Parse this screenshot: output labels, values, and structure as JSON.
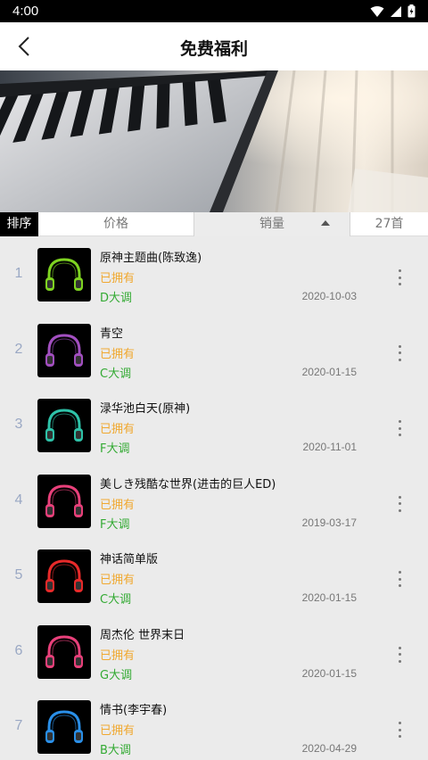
{
  "status_bar": {
    "time": "4:00"
  },
  "header": {
    "title": "免费福利"
  },
  "sort_bar": {
    "label": "排序",
    "price": "价格",
    "sales": "销量",
    "count": "27首"
  },
  "songs": [
    {
      "rank": "1",
      "title": "原神主题曲(陈致逸)",
      "owned": "已拥有",
      "key": "D大调",
      "date": "2020-10-03",
      "accent": "#7ed321"
    },
    {
      "rank": "2",
      "title": "青空",
      "owned": "已拥有",
      "key": "C大调",
      "date": "2020-01-15",
      "accent": "#a24fc0"
    },
    {
      "rank": "3",
      "title": "渌华池白天(原神)",
      "owned": "已拥有",
      "key": "F大调",
      "date": "2020-11-01",
      "accent": "#2ec2a8"
    },
    {
      "rank": "4",
      "title": "美しき残酷な世界(进击的巨人ED)",
      "owned": "已拥有",
      "key": "F大调",
      "date": "2019-03-17",
      "accent": "#e8407a"
    },
    {
      "rank": "5",
      "title": "神话简单版",
      "owned": "已拥有",
      "key": "C大调",
      "date": "2020-01-15",
      "accent": "#e82a2a"
    },
    {
      "rank": "6",
      "title": "周杰伦 世界末日",
      "owned": "已拥有",
      "key": "G大调",
      "date": "2020-01-15",
      "accent": "#e8407a"
    },
    {
      "rank": "7",
      "title": "情书(李宇春)",
      "owned": "已拥有",
      "key": "B大调",
      "date": "2020-04-29",
      "accent": "#2a8fe8"
    }
  ],
  "colors": {
    "owned": "#f0a830",
    "key": "#33aa33",
    "rank": "#9aa8c4"
  }
}
